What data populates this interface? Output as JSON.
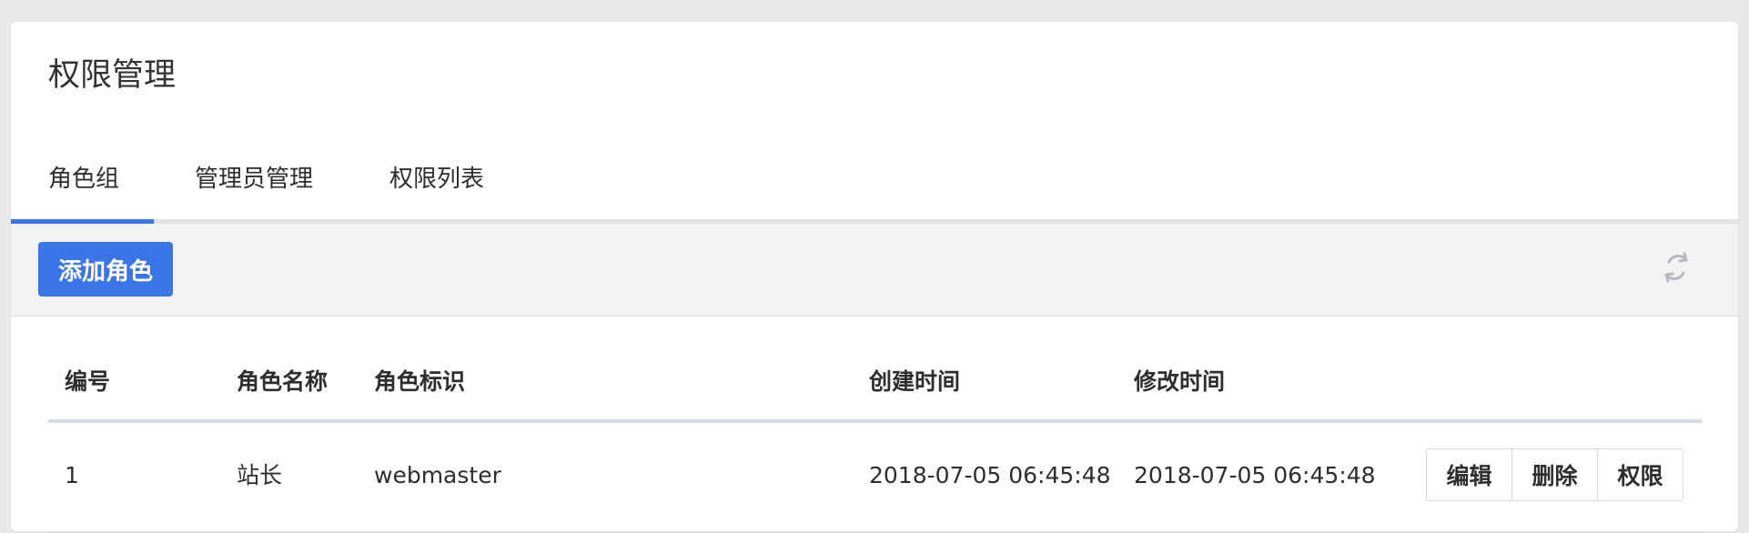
{
  "page": {
    "title": "权限管理"
  },
  "tabs": [
    {
      "label": "角色组",
      "active": true
    },
    {
      "label": "管理员管理",
      "active": false
    },
    {
      "label": "权限列表",
      "active": false
    }
  ],
  "toolbar": {
    "add_button_label": "添加角色",
    "refresh_icon": "refresh-icon"
  },
  "table": {
    "headers": [
      "编号",
      "角色名称",
      "角色标识",
      "创建时间",
      "修改时间"
    ],
    "rows": [
      {
        "id": "1",
        "name": "站长",
        "identifier": "webmaster",
        "created_at": "2018-07-05 06:45:48",
        "updated_at": "2018-07-05 06:45:48",
        "actions": [
          "编辑",
          "删除",
          "权限"
        ]
      }
    ]
  },
  "colors": {
    "accent": "#3a76e8",
    "background": "#e9e9e9",
    "toolbar": "#f2f2f2",
    "text": "#333333"
  }
}
